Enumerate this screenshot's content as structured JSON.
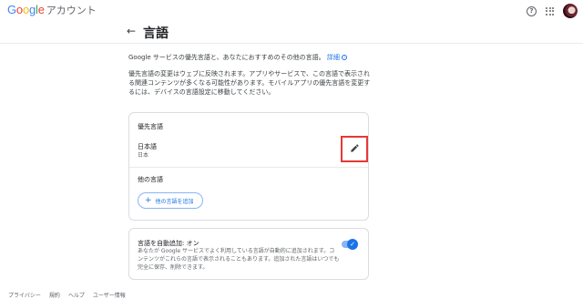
{
  "app": {
    "logo_google": "Google",
    "logo_product": "アカウント"
  },
  "header": {
    "back_icon": "arrow-back-icon",
    "title": "言語"
  },
  "intro": {
    "text": "Google サービスの優先言語と、あなたにおすすめのその他の言語。",
    "link_label": "詳細",
    "link_icon": "info-icon",
    "description": "優先言語の変更はウェブに反映されます。アプリやサービスで、この言語で表示される関連コンテンツが多くなる可能性があります。モバイルアプリの優先言語を変更するには、デバイスの言語設定に移動してください。"
  },
  "preferred": {
    "heading": "優先言語",
    "language": "日本語",
    "region": "日本",
    "edit_icon": "pencil-icon"
  },
  "other": {
    "heading": "他の言語",
    "add_label": "他の言語を追加",
    "add_icon": "plus-icon"
  },
  "auto_add": {
    "title": "言語を自動追加: オン",
    "description": "あなたが Google サービスでよく利用している言語が自動的に追加されます。コンテンツがこれらの言語で表示されることもあります。追加された言語はいつでも完全に保存、削除できます。",
    "enabled": true
  },
  "footer": {
    "links": [
      "プライバシー",
      "規約",
      "ヘルプ",
      "ユーザー情報"
    ]
  },
  "colors": {
    "accent": "#1a73e8",
    "highlight": "#e53935"
  }
}
